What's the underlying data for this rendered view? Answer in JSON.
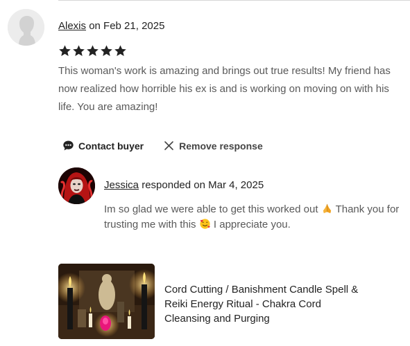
{
  "review": {
    "reviewer_name": "Alexis",
    "date_text": "on Feb 21, 2025",
    "rating": 5,
    "rating_max": 5,
    "text": "This woman's work is amazing and brings out true results! My friend has now realized how horrible his ex is and is working on moving on with his life. You are amazing!"
  },
  "actions": {
    "contact_label": "Contact buyer",
    "remove_label": "Remove response"
  },
  "response": {
    "seller_name": "Jessica",
    "responded_text": "responded on Mar 4, 2025",
    "text_part1": "Im so glad we were able to get this worked out",
    "text_part2": "Thank you for trusting me with this",
    "text_part3": "I appreciate you."
  },
  "product": {
    "title": "Cord Cutting / Banishment Candle Spell & Reiki Energy Ritual - Chakra Cord Cleansing and Purging"
  },
  "icons": {
    "star_color": "#222222",
    "chat": "chat-bubble-icon",
    "remove": "close-icon",
    "pray": "folded-hands-emoji",
    "heart_face": "smiling-face-with-hearts-emoji"
  }
}
